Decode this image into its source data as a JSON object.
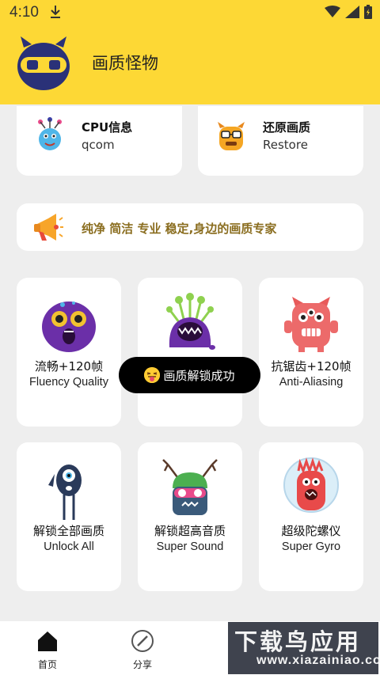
{
  "status_bar": {
    "time": "4:10"
  },
  "app_bar": {
    "title": "画质怪物"
  },
  "info_cards": [
    {
      "title": "CPU信息",
      "subtitle": "qcom",
      "icon": "cpu-monster-icon"
    },
    {
      "title": "还原画质",
      "subtitle": "Restore",
      "icon": "restore-monster-icon"
    }
  ],
  "banner": {
    "text": "纯净 简洁 专业 稳定,身边的画质专家",
    "icon": "megaphone-icon"
  },
  "features": [
    {
      "cn": "流畅+120帧",
      "en": "Fluency Quality",
      "icon": "purple-monster-icon"
    },
    {
      "cn": "",
      "en": "",
      "icon": "antenna-monster-icon"
    },
    {
      "cn": "抗锯齿+120帧",
      "en": "Anti-Aliasing",
      "icon": "red-robot-monster-icon"
    },
    {
      "cn": "解锁全部画质",
      "en": "Unlock All",
      "icon": "one-eye-monster-icon"
    },
    {
      "cn": "解锁超高音质",
      "en": "Super Sound",
      "icon": "antler-monster-icon"
    },
    {
      "cn": "超级陀螺仪",
      "en": "Super Gyro",
      "icon": "bubble-monster-icon"
    }
  ],
  "toast": {
    "text": "画质解锁成功"
  },
  "bottom_nav": [
    {
      "label": "首页",
      "icon": "home-icon",
      "active": true
    },
    {
      "label": "分享",
      "icon": "compass-icon",
      "active": false
    }
  ],
  "watermark": {
    "title": "下载鸟应用",
    "url": "www.xiazainiao.com"
  },
  "colors": {
    "accent": "#fdd835",
    "background": "#eeeeee",
    "banner_text": "#8a6d1f"
  }
}
